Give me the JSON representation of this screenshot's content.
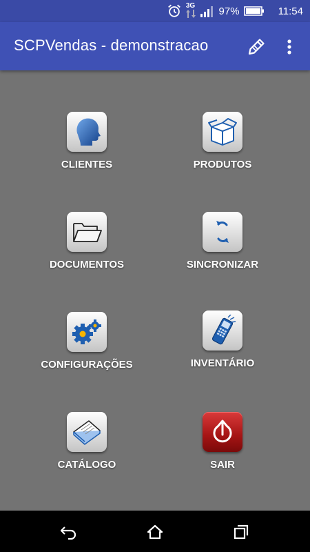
{
  "status_bar": {
    "network": "3G",
    "battery": "97%",
    "time": "11:54",
    "icons": [
      "alarm-icon",
      "network-3g-icon",
      "signal-icon",
      "battery-icon"
    ]
  },
  "app_bar": {
    "title": "SCPVendas - demonstracao",
    "actions": [
      "edit-icon",
      "more-vert-icon"
    ]
  },
  "menu": {
    "clientes": {
      "label": "CLIENTES",
      "icon": "person-head-icon"
    },
    "produtos": {
      "label": "PRODUTOS",
      "icon": "box-icon"
    },
    "documentos": {
      "label": "DOCUMENTOS",
      "icon": "folder-icon"
    },
    "sincronizar": {
      "label": "SINCRONIZAR",
      "icon": "sync-arrows-icon"
    },
    "configuracoes": {
      "label": "CONFIGURAÇÕES",
      "icon": "gears-icon"
    },
    "inventario": {
      "label": "INVENTÁRIO",
      "icon": "handheld-scanner-icon"
    },
    "catalogo": {
      "label": "CATÁLOGO",
      "icon": "catalog-book-icon"
    },
    "sair": {
      "label": "SAIR",
      "icon": "power-icon"
    }
  },
  "colors": {
    "app_bar": "#3f51b5",
    "status_bar": "#3a4aa6",
    "background": "#737373",
    "exit_button": "#b71c1c",
    "icon_blue": "#1f5fb0"
  },
  "nav_bar": [
    "back-icon",
    "home-icon",
    "recents-icon"
  ]
}
